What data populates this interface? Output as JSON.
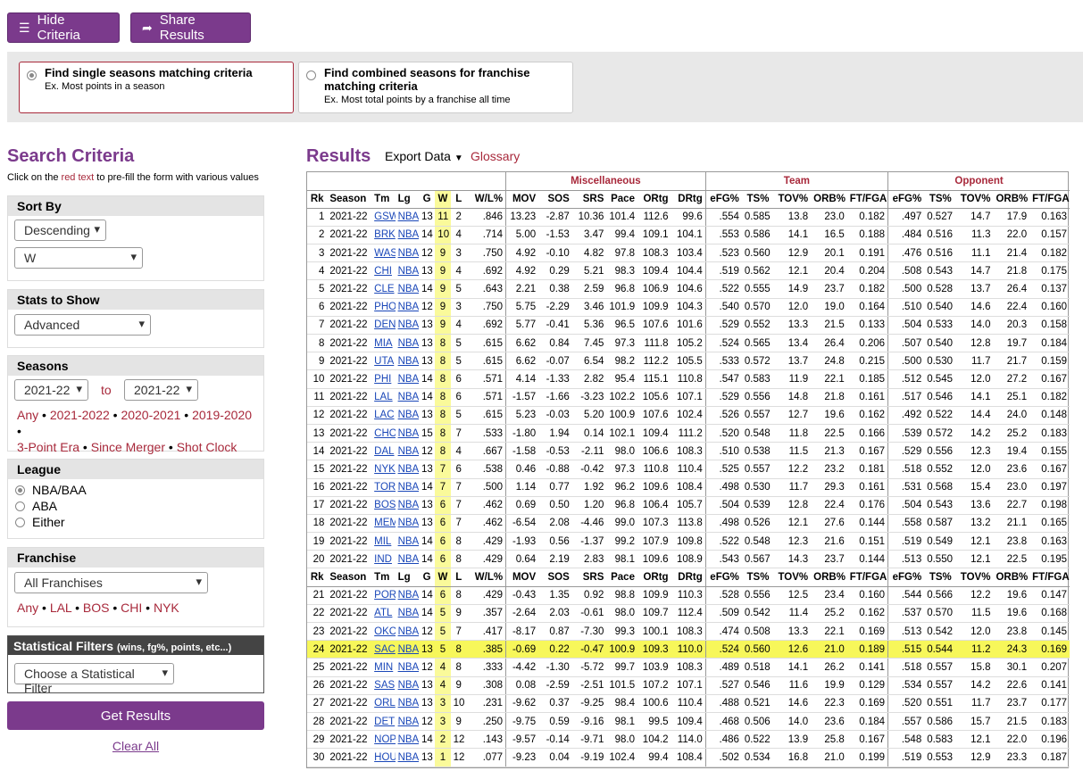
{
  "top_buttons": {
    "hide_criteria": "Hide Criteria",
    "share_results": "Share Results"
  },
  "modes": {
    "single": {
      "title": "Find single seasons matching criteria",
      "example": "Ex. Most points in a season",
      "selected": true
    },
    "combined": {
      "title": "Find combined seasons for franchise matching criteria",
      "example": "Ex. Most total points by a franchise all time",
      "selected": false
    }
  },
  "criteria": {
    "title": "Search Criteria",
    "subtitle_pre": "Click on the ",
    "subtitle_red": "red text",
    "subtitle_post": " to pre-fill the form with various values",
    "sort_by": {
      "label": "Sort By",
      "order": "Descending",
      "stat": "W"
    },
    "stats_to_show": {
      "label": "Stats to Show",
      "value": "Advanced"
    },
    "seasons": {
      "label": "Seasons",
      "from": "2021-22",
      "to_label": "to",
      "to": "2021-22",
      "quick": [
        "Any",
        "2021-2022",
        "2020-2021",
        "2019-2020",
        "3-Point Era",
        "Since Merger",
        "Shot Clock Era"
      ]
    },
    "league": {
      "label": "League",
      "options": [
        "NBA/BAA",
        "ABA",
        "Either"
      ],
      "selected": "NBA/BAA"
    },
    "franchise": {
      "label": "Franchise",
      "value": "All Franchises",
      "quick": [
        "Any",
        "LAL",
        "BOS",
        "CHI",
        "NYK"
      ]
    },
    "stat_filters": {
      "label": "Statistical Filters",
      "hint": "(wins, fg%, points, etc...)",
      "value": "Choose a Statistical Filter"
    },
    "get_results": "Get Results",
    "clear_all": "Clear All"
  },
  "results": {
    "title": "Results",
    "export": "Export Data",
    "glossary": "Glossary",
    "groups": [
      "Miscellaneous",
      "Team",
      "Opponent"
    ],
    "columns": [
      "Rk",
      "Season",
      "Tm",
      "Lg",
      "G",
      "W",
      "L",
      "W/L%",
      "MOV",
      "SOS",
      "SRS",
      "Pace",
      "ORtg",
      "DRtg",
      "eFG%",
      "TS%",
      "TOV%",
      "ORB%",
      "FT/FGA",
      "eFG%",
      "TS%",
      "TOV%",
      "ORB%",
      "FT/FGA"
    ],
    "rows": [
      [
        "1",
        "2021-22",
        "GSW",
        "NBA",
        "13",
        "11",
        "2",
        ".846",
        "13.23",
        "-2.87",
        "10.36",
        "101.4",
        "112.6",
        "99.6",
        ".554",
        "0.585",
        "13.8",
        "23.0",
        "0.182",
        ".497",
        "0.527",
        "14.7",
        "17.9",
        "0.163"
      ],
      [
        "2",
        "2021-22",
        "BRK",
        "NBA",
        "14",
        "10",
        "4",
        ".714",
        "5.00",
        "-1.53",
        "3.47",
        "99.4",
        "109.1",
        "104.1",
        ".553",
        "0.586",
        "14.1",
        "16.5",
        "0.188",
        ".484",
        "0.516",
        "11.3",
        "22.0",
        "0.157"
      ],
      [
        "3",
        "2021-22",
        "WAS",
        "NBA",
        "12",
        "9",
        "3",
        ".750",
        "4.92",
        "-0.10",
        "4.82",
        "97.8",
        "108.3",
        "103.4",
        ".523",
        "0.560",
        "12.9",
        "20.1",
        "0.191",
        ".476",
        "0.516",
        "11.1",
        "21.4",
        "0.182"
      ],
      [
        "4",
        "2021-22",
        "CHI",
        "NBA",
        "13",
        "9",
        "4",
        ".692",
        "4.92",
        "0.29",
        "5.21",
        "98.3",
        "109.4",
        "104.4",
        ".519",
        "0.562",
        "12.1",
        "20.4",
        "0.204",
        ".508",
        "0.543",
        "14.7",
        "21.8",
        "0.175"
      ],
      [
        "5",
        "2021-22",
        "CLE",
        "NBA",
        "14",
        "9",
        "5",
        ".643",
        "2.21",
        "0.38",
        "2.59",
        "96.8",
        "106.9",
        "104.6",
        ".522",
        "0.555",
        "14.9",
        "23.7",
        "0.182",
        ".500",
        "0.528",
        "13.7",
        "26.4",
        "0.137"
      ],
      [
        "6",
        "2021-22",
        "PHO",
        "NBA",
        "12",
        "9",
        "3",
        ".750",
        "5.75",
        "-2.29",
        "3.46",
        "101.9",
        "109.9",
        "104.3",
        ".540",
        "0.570",
        "12.0",
        "19.0",
        "0.164",
        ".510",
        "0.540",
        "14.6",
        "22.4",
        "0.160"
      ],
      [
        "7",
        "2021-22",
        "DEN",
        "NBA",
        "13",
        "9",
        "4",
        ".692",
        "5.77",
        "-0.41",
        "5.36",
        "96.5",
        "107.6",
        "101.6",
        ".529",
        "0.552",
        "13.3",
        "21.5",
        "0.133",
        ".504",
        "0.533",
        "14.0",
        "20.3",
        "0.158"
      ],
      [
        "8",
        "2021-22",
        "MIA",
        "NBA",
        "13",
        "8",
        "5",
        ".615",
        "6.62",
        "0.84",
        "7.45",
        "97.3",
        "111.8",
        "105.2",
        ".524",
        "0.565",
        "13.4",
        "26.4",
        "0.206",
        ".507",
        "0.540",
        "12.8",
        "19.7",
        "0.184"
      ],
      [
        "9",
        "2021-22",
        "UTA",
        "NBA",
        "13",
        "8",
        "5",
        ".615",
        "6.62",
        "-0.07",
        "6.54",
        "98.2",
        "112.2",
        "105.5",
        ".533",
        "0.572",
        "13.7",
        "24.8",
        "0.215",
        ".500",
        "0.530",
        "11.7",
        "21.7",
        "0.159"
      ],
      [
        "10",
        "2021-22",
        "PHI",
        "NBA",
        "14",
        "8",
        "6",
        ".571",
        "4.14",
        "-1.33",
        "2.82",
        "95.4",
        "115.1",
        "110.8",
        ".547",
        "0.583",
        "11.9",
        "22.1",
        "0.185",
        ".512",
        "0.545",
        "12.0",
        "27.2",
        "0.167"
      ],
      [
        "11",
        "2021-22",
        "LAL",
        "NBA",
        "14",
        "8",
        "6",
        ".571",
        "-1.57",
        "-1.66",
        "-3.23",
        "102.2",
        "105.6",
        "107.1",
        ".529",
        "0.556",
        "14.8",
        "21.8",
        "0.161",
        ".517",
        "0.546",
        "14.1",
        "25.1",
        "0.182"
      ],
      [
        "12",
        "2021-22",
        "LAC",
        "NBA",
        "13",
        "8",
        "5",
        ".615",
        "5.23",
        "-0.03",
        "5.20",
        "100.9",
        "107.6",
        "102.4",
        ".526",
        "0.557",
        "12.7",
        "19.6",
        "0.162",
        ".492",
        "0.522",
        "14.4",
        "24.0",
        "0.148"
      ],
      [
        "13",
        "2021-22",
        "CHO",
        "NBA",
        "15",
        "8",
        "7",
        ".533",
        "-1.80",
        "1.94",
        "0.14",
        "102.1",
        "109.4",
        "111.2",
        ".520",
        "0.548",
        "11.8",
        "22.5",
        "0.166",
        ".539",
        "0.572",
        "14.2",
        "25.2",
        "0.183"
      ],
      [
        "14",
        "2021-22",
        "DAL",
        "NBA",
        "12",
        "8",
        "4",
        ".667",
        "-1.58",
        "-0.53",
        "-2.11",
        "98.0",
        "106.6",
        "108.3",
        ".510",
        "0.538",
        "11.5",
        "21.3",
        "0.167",
        ".529",
        "0.556",
        "12.3",
        "19.4",
        "0.155"
      ],
      [
        "15",
        "2021-22",
        "NYK",
        "NBA",
        "13",
        "7",
        "6",
        ".538",
        "0.46",
        "-0.88",
        "-0.42",
        "97.3",
        "110.8",
        "110.4",
        ".525",
        "0.557",
        "12.2",
        "23.2",
        "0.181",
        ".518",
        "0.552",
        "12.0",
        "23.6",
        "0.167"
      ],
      [
        "16",
        "2021-22",
        "TOR",
        "NBA",
        "14",
        "7",
        "7",
        ".500",
        "1.14",
        "0.77",
        "1.92",
        "96.2",
        "109.6",
        "108.4",
        ".498",
        "0.530",
        "11.7",
        "29.3",
        "0.161",
        ".531",
        "0.568",
        "15.4",
        "23.0",
        "0.197"
      ],
      [
        "17",
        "2021-22",
        "BOS",
        "NBA",
        "13",
        "6",
        "7",
        ".462",
        "0.69",
        "0.50",
        "1.20",
        "96.8",
        "106.4",
        "105.7",
        ".504",
        "0.539",
        "12.8",
        "22.4",
        "0.176",
        ".504",
        "0.543",
        "13.6",
        "22.7",
        "0.198"
      ],
      [
        "18",
        "2021-22",
        "MEM",
        "NBA",
        "13",
        "6",
        "7",
        ".462",
        "-6.54",
        "2.08",
        "-4.46",
        "99.0",
        "107.3",
        "113.8",
        ".498",
        "0.526",
        "12.1",
        "27.6",
        "0.144",
        ".558",
        "0.587",
        "13.2",
        "21.1",
        "0.165"
      ],
      [
        "19",
        "2021-22",
        "MIL",
        "NBA",
        "14",
        "6",
        "8",
        ".429",
        "-1.93",
        "0.56",
        "-1.37",
        "99.2",
        "107.9",
        "109.8",
        ".522",
        "0.548",
        "12.3",
        "21.6",
        "0.151",
        ".519",
        "0.549",
        "12.1",
        "23.8",
        "0.163"
      ],
      [
        "20",
        "2021-22",
        "IND",
        "NBA",
        "14",
        "6",
        "8",
        ".429",
        "0.64",
        "2.19",
        "2.83",
        "98.1",
        "109.6",
        "108.9",
        ".543",
        "0.567",
        "14.3",
        "23.7",
        "0.144",
        ".513",
        "0.550",
        "12.1",
        "22.5",
        "0.195"
      ],
      [
        "21",
        "2021-22",
        "POR",
        "NBA",
        "14",
        "6",
        "8",
        ".429",
        "-0.43",
        "1.35",
        "0.92",
        "98.8",
        "109.9",
        "110.3",
        ".528",
        "0.556",
        "12.5",
        "23.4",
        "0.160",
        ".544",
        "0.566",
        "12.2",
        "19.6",
        "0.147"
      ],
      [
        "22",
        "2021-22",
        "ATL",
        "NBA",
        "14",
        "5",
        "9",
        ".357",
        "-2.64",
        "2.03",
        "-0.61",
        "98.0",
        "109.7",
        "112.4",
        ".509",
        "0.542",
        "11.4",
        "25.2",
        "0.162",
        ".537",
        "0.570",
        "11.5",
        "19.6",
        "0.168"
      ],
      [
        "23",
        "2021-22",
        "OKC",
        "NBA",
        "12",
        "5",
        "7",
        ".417",
        "-8.17",
        "0.87",
        "-7.30",
        "99.3",
        "100.1",
        "108.3",
        ".474",
        "0.508",
        "13.3",
        "22.1",
        "0.169",
        ".513",
        "0.542",
        "12.0",
        "23.8",
        "0.145"
      ],
      [
        "24",
        "2021-22",
        "SAC",
        "NBA",
        "13",
        "5",
        "8",
        ".385",
        "-0.69",
        "0.22",
        "-0.47",
        "100.9",
        "109.3",
        "110.0",
        ".524",
        "0.560",
        "12.6",
        "21.0",
        "0.189",
        ".515",
        "0.544",
        "11.2",
        "24.3",
        "0.169"
      ],
      [
        "25",
        "2021-22",
        "MIN",
        "NBA",
        "12",
        "4",
        "8",
        ".333",
        "-4.42",
        "-1.30",
        "-5.72",
        "99.7",
        "103.9",
        "108.3",
        ".489",
        "0.518",
        "14.1",
        "26.2",
        "0.141",
        ".518",
        "0.557",
        "15.8",
        "30.1",
        "0.207"
      ],
      [
        "26",
        "2021-22",
        "SAS",
        "NBA",
        "13",
        "4",
        "9",
        ".308",
        "0.08",
        "-2.59",
        "-2.51",
        "101.5",
        "107.2",
        "107.1",
        ".527",
        "0.546",
        "11.6",
        "19.9",
        "0.129",
        ".534",
        "0.557",
        "14.2",
        "22.6",
        "0.141"
      ],
      [
        "27",
        "2021-22",
        "ORL",
        "NBA",
        "13",
        "3",
        "10",
        ".231",
        "-9.62",
        "0.37",
        "-9.25",
        "98.4",
        "100.6",
        "110.4",
        ".488",
        "0.521",
        "14.6",
        "22.3",
        "0.169",
        ".520",
        "0.551",
        "11.7",
        "23.7",
        "0.177"
      ],
      [
        "28",
        "2021-22",
        "DET",
        "NBA",
        "12",
        "3",
        "9",
        ".250",
        "-9.75",
        "0.59",
        "-9.16",
        "98.1",
        "99.5",
        "109.4",
        ".468",
        "0.506",
        "14.0",
        "23.6",
        "0.184",
        ".557",
        "0.586",
        "15.7",
        "21.5",
        "0.183"
      ],
      [
        "29",
        "2021-22",
        "NOP",
        "NBA",
        "14",
        "2",
        "12",
        ".143",
        "-9.57",
        "-0.14",
        "-9.71",
        "98.0",
        "104.2",
        "114.0",
        ".486",
        "0.522",
        "13.9",
        "25.8",
        "0.167",
        ".548",
        "0.583",
        "12.1",
        "22.0",
        "0.196"
      ],
      [
        "30",
        "2021-22",
        "HOU",
        "NBA",
        "13",
        "1",
        "12",
        ".077",
        "-9.23",
        "0.04",
        "-9.19",
        "102.4",
        "99.4",
        "108.4",
        ".502",
        "0.534",
        "16.8",
        "21.0",
        "0.199",
        ".519",
        "0.553",
        "12.9",
        "23.3",
        "0.187"
      ]
    ],
    "highlight_row": "24",
    "repeat_header_after": 20
  }
}
